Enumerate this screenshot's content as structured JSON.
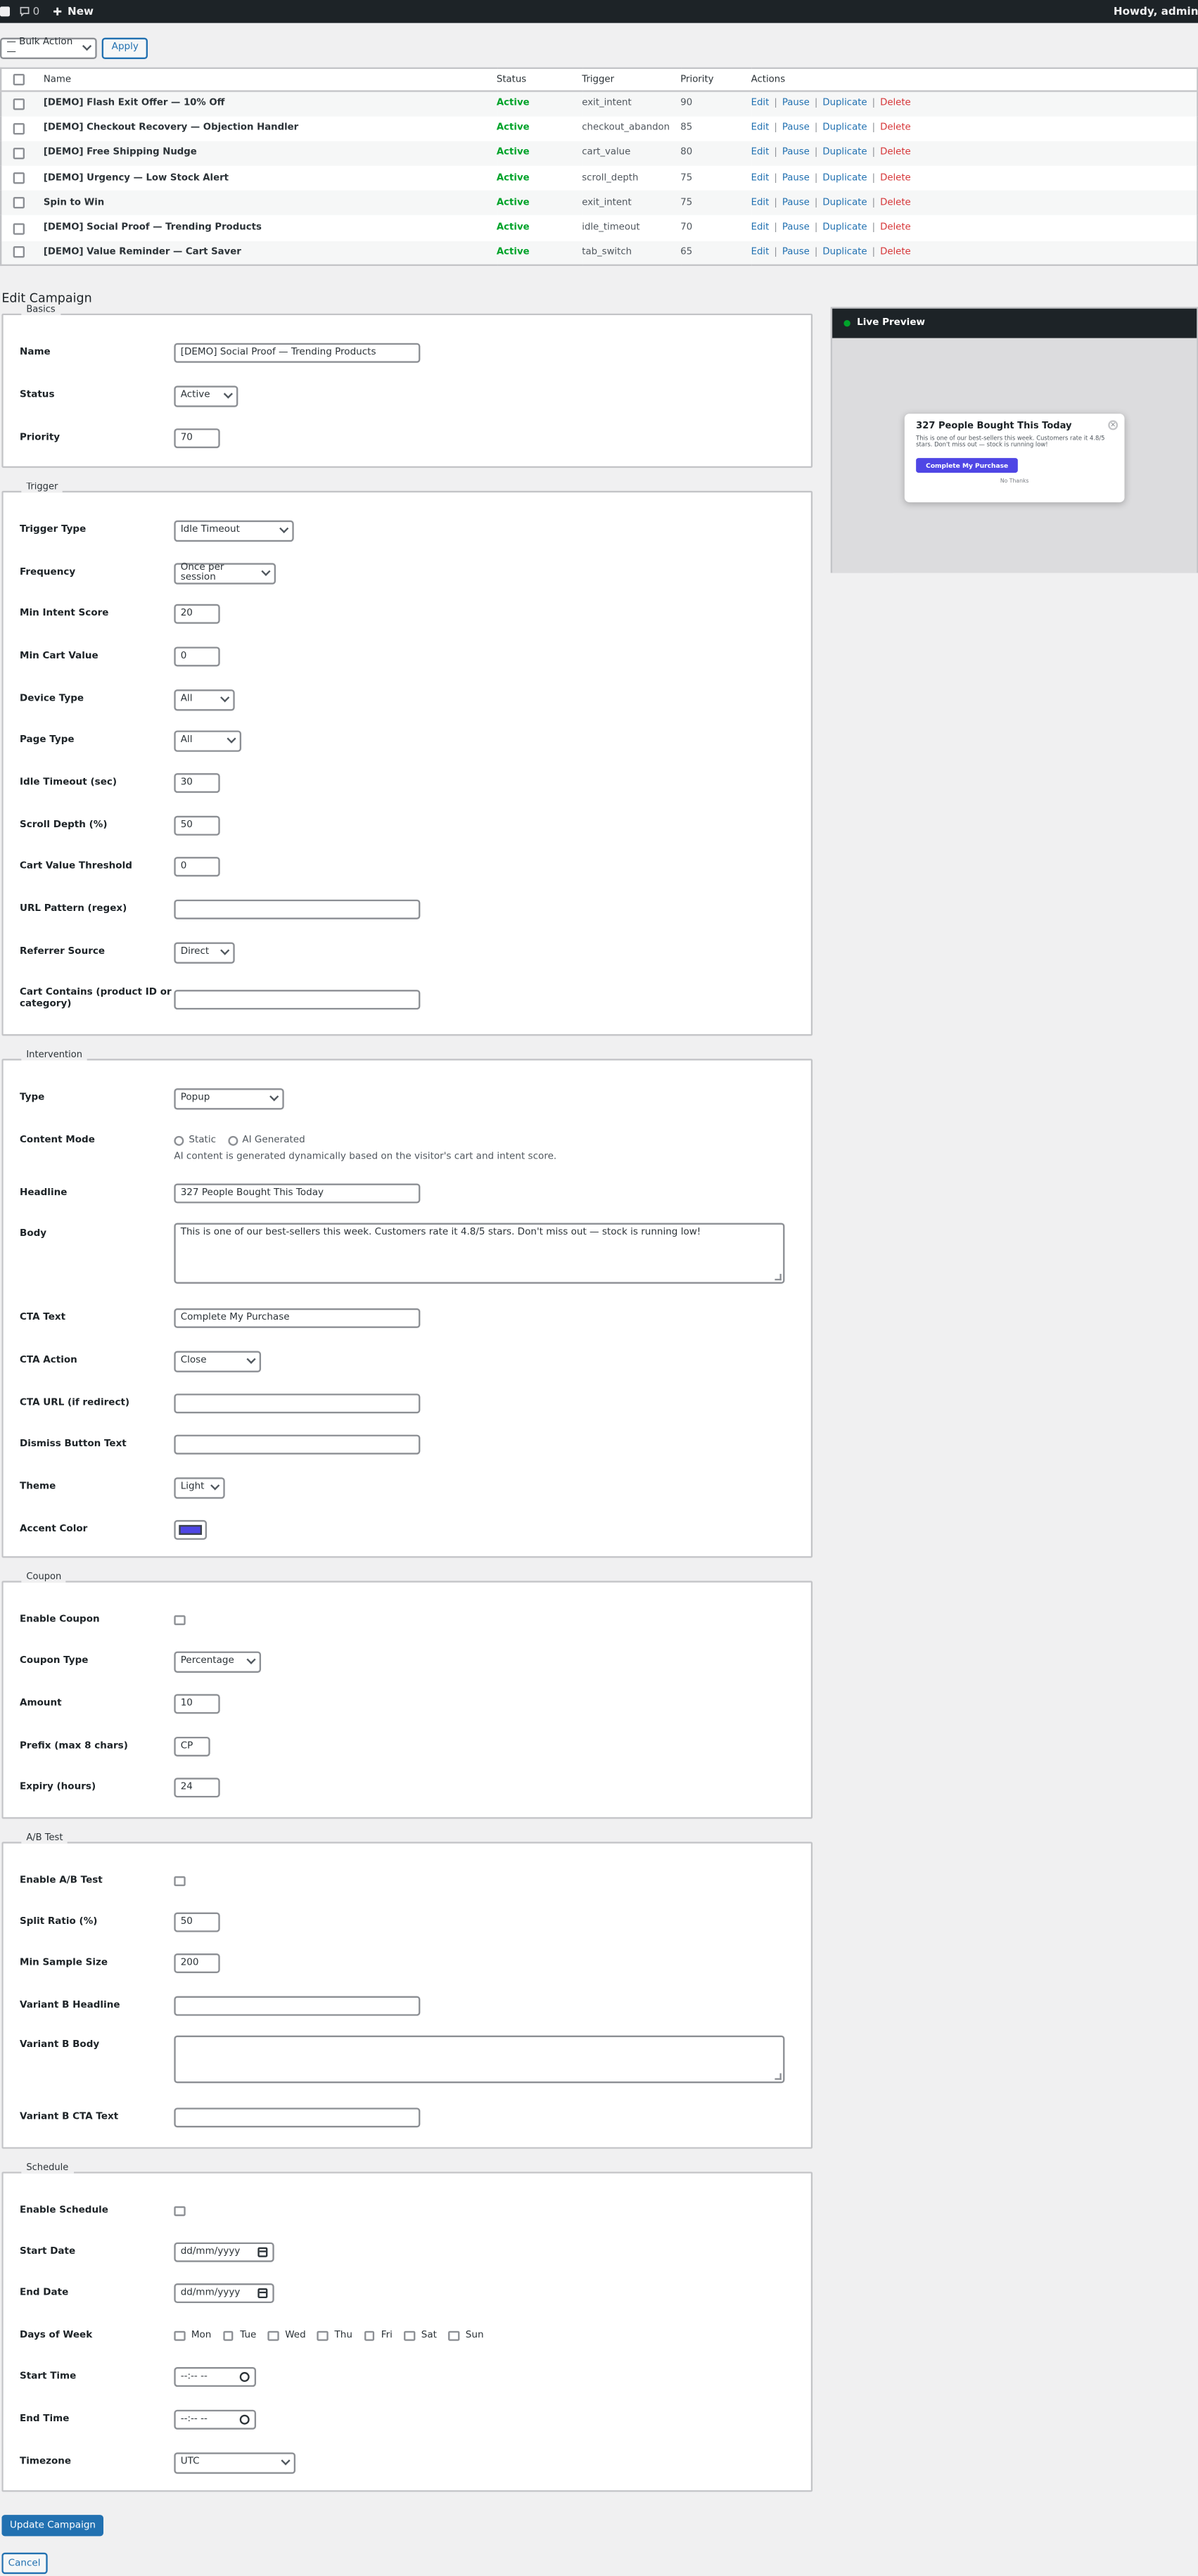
{
  "adminbar": {
    "comments_count": "0",
    "new_label": "New",
    "howdy": "Howdy, admin"
  },
  "bulk": {
    "select_value": "— Bulk Action —",
    "apply": "Apply"
  },
  "table": {
    "headers": {
      "name": "Name",
      "status": "Status",
      "trigger": "Trigger",
      "priority": "Priority",
      "actions": "Actions"
    },
    "actions": {
      "edit": "Edit",
      "pause": "Pause",
      "duplicate": "Duplicate",
      "delete": "Delete"
    },
    "rows": [
      {
        "name": "[DEMO] Flash Exit Offer — 10% Off",
        "status": "Active",
        "trigger": "exit_intent",
        "priority": "90"
      },
      {
        "name": "[DEMO] Checkout Recovery — Objection Handler",
        "status": "Active",
        "trigger": "checkout_abandon",
        "priority": "85"
      },
      {
        "name": "[DEMO] Free Shipping Nudge",
        "status": "Active",
        "trigger": "cart_value",
        "priority": "80"
      },
      {
        "name": "[DEMO] Urgency — Low Stock Alert",
        "status": "Active",
        "trigger": "scroll_depth",
        "priority": "75"
      },
      {
        "name": "Spin to Win",
        "status": "Active",
        "trigger": "exit_intent",
        "priority": "75"
      },
      {
        "name": "[DEMO] Social Proof — Trending Products",
        "status": "Active",
        "trigger": "idle_timeout",
        "priority": "70"
      },
      {
        "name": "[DEMO] Value Reminder — Cart Saver",
        "status": "Active",
        "trigger": "tab_switch",
        "priority": "65"
      }
    ]
  },
  "edit": {
    "title": "Edit Campaign",
    "basics": {
      "legend": "Basics",
      "name_label": "Name",
      "name_value": "[DEMO] Social Proof — Trending Products",
      "status_label": "Status",
      "status_value": "Active",
      "priority_label": "Priority",
      "priority_value": "70"
    },
    "trigger": {
      "legend": "Trigger",
      "type_label": "Trigger Type",
      "type_value": "Idle Timeout",
      "frequency_label": "Frequency",
      "frequency_value": "Once per session",
      "intent_label": "Min Intent Score",
      "intent_value": "20",
      "cart_label": "Min Cart Value",
      "cart_value": "0",
      "device_label": "Device Type",
      "device_value": "All",
      "page_label": "Page Type",
      "page_value": "All",
      "idle_label": "Idle Timeout (sec)",
      "idle_value": "30",
      "scroll_label": "Scroll Depth (%)",
      "scroll_value": "50",
      "threshold_label": "Cart Value Threshold",
      "threshold_value": "0",
      "url_label": "URL Pattern (regex)",
      "url_value": "",
      "referrer_label": "Referrer Source",
      "referrer_value": "Direct",
      "contains_label": "Cart Contains (product ID or category)",
      "contains_value": ""
    },
    "intervention": {
      "legend": "Intervention",
      "type_label": "Type",
      "type_value": "Popup",
      "mode_label": "Content Mode",
      "mode_static": "Static",
      "mode_ai": "AI Generated",
      "mode_hint": "AI content is generated dynamically based on the visitor's cart and intent score.",
      "headline_label": "Headline",
      "headline_value": "327 People Bought This Today",
      "body_label": "Body",
      "body_value": "This is one of our best-sellers this week. Customers rate it 4.8/5 stars. Don't miss out — stock is running low!",
      "cta_text_label": "CTA Text",
      "cta_text_value": "Complete My Purchase",
      "cta_action_label": "CTA Action",
      "cta_action_value": "Close",
      "cta_url_label": "CTA URL (if redirect)",
      "cta_url_value": "",
      "dismiss_label": "Dismiss Button Text",
      "dismiss_value": "",
      "theme_label": "Theme",
      "theme_value": "Light",
      "accent_label": "Accent Color",
      "accent_value": "#4f46e5"
    },
    "coupon": {
      "legend": "Coupon",
      "enable_label": "Enable Coupon",
      "type_label": "Coupon Type",
      "type_value": "Percentage",
      "amount_label": "Amount",
      "amount_value": "10",
      "prefix_label": "Prefix (max 8 chars)",
      "prefix_value": "CP",
      "expiry_label": "Expiry (hours)",
      "expiry_value": "24"
    },
    "ab": {
      "legend": "A/B Test",
      "enable_label": "Enable A/B Test",
      "split_label": "Split Ratio (%)",
      "split_value": "50",
      "sample_label": "Min Sample Size",
      "sample_value": "200",
      "vb_headline_label": "Variant B Headline",
      "vb_headline_value": "",
      "vb_body_label": "Variant B Body",
      "vb_body_value": "",
      "vb_cta_label": "Variant B CTA Text",
      "vb_cta_value": ""
    },
    "schedule": {
      "legend": "Schedule",
      "enable_label": "Enable Schedule",
      "start_date_label": "Start Date",
      "start_date_value": "dd/mm/yyyy",
      "end_date_label": "End Date",
      "end_date_value": "dd/mm/yyyy",
      "days_label": "Days of Week",
      "days": [
        "Mon",
        "Tue",
        "Wed",
        "Thu",
        "Fri",
        "Sat",
        "Sun"
      ],
      "start_time_label": "Start Time",
      "start_time_value": "--:-- --",
      "end_time_label": "End Time",
      "end_time_value": "--:-- --",
      "timezone_label": "Timezone",
      "timezone_value": "UTC"
    },
    "update_button": "Update Campaign",
    "cancel_button": "Cancel"
  },
  "preview": {
    "title": "Live Preview",
    "headline": "327 People Bought This Today",
    "body": "This is one of our best-sellers this week. Customers rate it 4.8/5 stars. Don't miss out — stock is running low!",
    "cta": "Complete My Purchase",
    "dismiss": "No Thanks",
    "close": "×"
  },
  "colors": {
    "accent": "#4f46e5",
    "primary": "#2271b1",
    "active": "#00a32a",
    "delete": "#d63638"
  }
}
